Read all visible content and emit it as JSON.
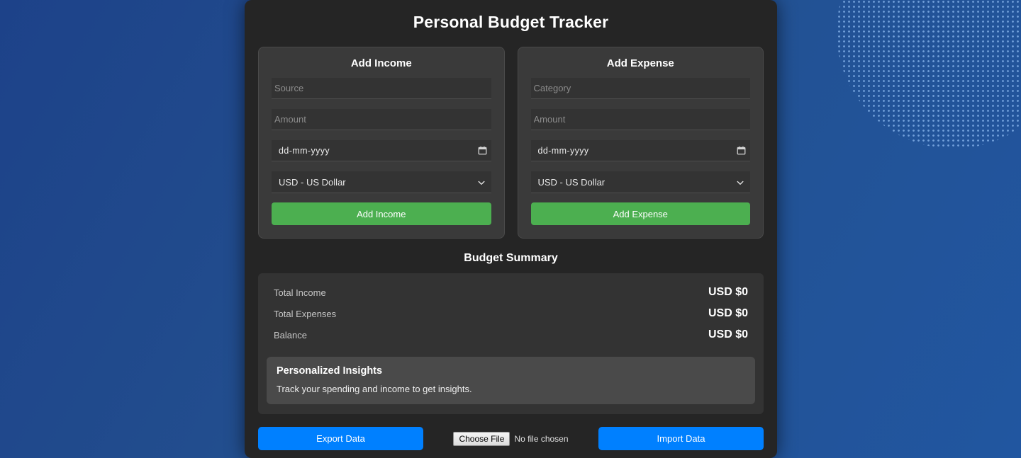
{
  "app": {
    "title": "Personal Budget Tracker"
  },
  "income_form": {
    "heading": "Add Income",
    "source_placeholder": "Source",
    "source_value": "",
    "amount_placeholder": "Amount",
    "amount_value": "",
    "date_display": "dd-mm-yyyy",
    "currency_selected": "USD - US Dollar",
    "submit_label": "Add Income"
  },
  "expense_form": {
    "heading": "Add Expense",
    "category_placeholder": "Category",
    "category_value": "",
    "amount_placeholder": "Amount",
    "amount_value": "",
    "date_display": "dd-mm-yyyy",
    "currency_selected": "USD - US Dollar",
    "submit_label": "Add Expense"
  },
  "summary": {
    "heading": "Budget Summary",
    "rows": [
      {
        "label": "Total Income",
        "value": "USD $0"
      },
      {
        "label": "Total Expenses",
        "value": "USD $0"
      },
      {
        "label": "Balance",
        "value": "USD $0"
      }
    ]
  },
  "insights": {
    "title": "Personalized Insights",
    "text": "Track your spending and income to get insights."
  },
  "actions": {
    "export_label": "Export Data",
    "import_label": "Import Data",
    "choose_file_label": "Choose File",
    "no_file_label": "No file chosen"
  },
  "colors": {
    "accent_green": "#4caf50",
    "accent_blue": "#0080ff",
    "page_background": "#1f4a93",
    "panel": "#252525",
    "card": "#3a3a3a",
    "field": "#333333",
    "insights_panel": "#4a4a4a"
  }
}
